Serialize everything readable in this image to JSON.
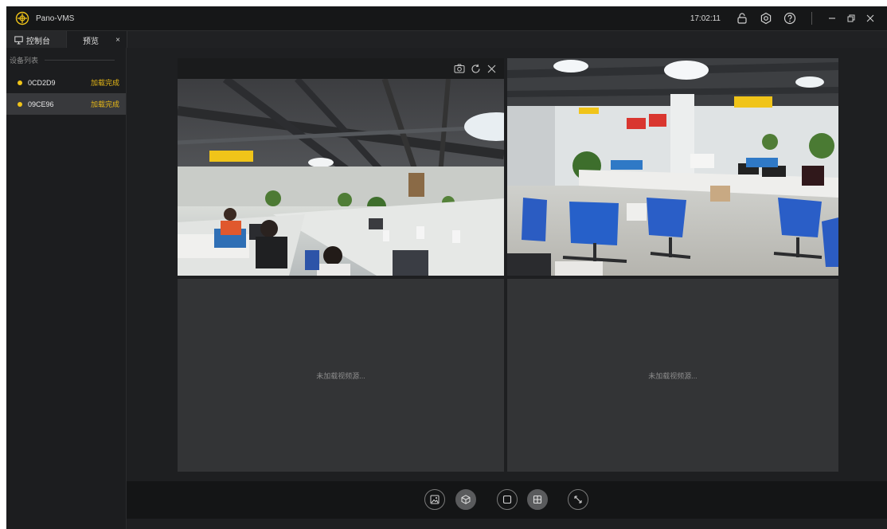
{
  "app": {
    "title": "Pano-VMS",
    "clock": "17:02:11",
    "accent": "#f0c419",
    "icons": [
      "logo-icon",
      "lock-icon",
      "settings-icon",
      "help-icon",
      "minimize-icon",
      "restore-icon",
      "close-icon"
    ]
  },
  "tabs": {
    "console": "控制台",
    "preview": "预览",
    "close": "×"
  },
  "sidebar": {
    "header": "设备列表",
    "devices": [
      {
        "id": "0CD2D9",
        "status": "加载完成"
      },
      {
        "id": "09CE96",
        "status": "加载完成"
      }
    ]
  },
  "viewer": {
    "empty_text_3": "未加载视频源...",
    "empty_text_4": "未加载视频源..."
  }
}
